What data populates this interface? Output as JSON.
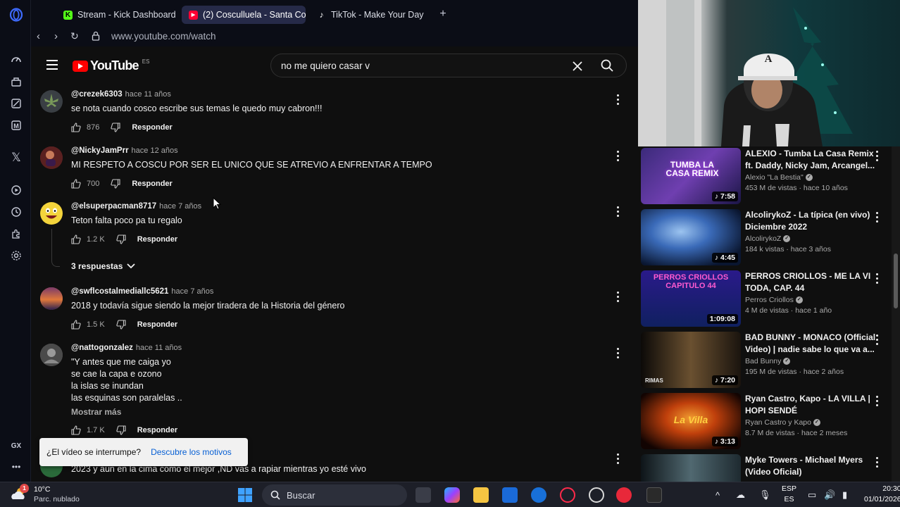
{
  "tabs": [
    {
      "label": "Stream - Kick Dashboard",
      "fav": "K",
      "fav_color": "#53fc18"
    },
    {
      "label": "(2) Cosculluela - Santa Co",
      "fav": "▶",
      "fav_color": "#ff0033"
    },
    {
      "label": "TikTok - Make Your Day",
      "fav": "♪",
      "fav_color": "#ffffff"
    }
  ],
  "address": {
    "url": "www.youtube.com/watch"
  },
  "youtube": {
    "logo_text": "YouTube",
    "country": "ES",
    "search_query": "no me quiero casar v"
  },
  "comments": [
    {
      "user": "@crezek6303",
      "time": "hace 11 años",
      "lines": [
        "se nota cuando cosco escribe sus temas le quedo muy cabron!!!"
      ],
      "likes": "876",
      "reply": "Responder"
    },
    {
      "user": "@NickyJamPrr",
      "time": "hace 12 años",
      "lines": [
        "MI RESPETO A COSCU POR SER EL UNICO QUE SE ATREVIO A ENFRENTAR A TEMPO"
      ],
      "likes": "700",
      "reply": "Responder"
    },
    {
      "user": "@elsuperpacman8717",
      "time": "hace 7 años",
      "lines": [
        "Teton falta poco pa tu regalo"
      ],
      "likes": "1.2 K",
      "reply": "Responder",
      "replies_label": "3 respuestas"
    },
    {
      "user": "@swflcostalmediallc5621",
      "time": "hace 7 años",
      "lines": [
        "2018 y todavía sigue siendo la mejor tiradera de la Historia del género"
      ],
      "likes": "1.5 K",
      "reply": "Responder"
    },
    {
      "user": "@nattogonzalez",
      "time": "hace 11 años",
      "lines": [
        "\"Y antes que me caiga yo",
        "se cae la capa e ozono",
        "la islas se inundan",
        "las esquinas son paralelas .."
      ],
      "more": "Mostrar más",
      "likes": "1.7 K",
      "reply": "Responder"
    },
    {
      "user": "",
      "time": "",
      "lines": [
        "2023 y aún en la cima como el mejor ,ND vas a rapiar mientras yo esté vivo"
      ],
      "likes": "",
      "reply": ""
    }
  ],
  "toast": {
    "text": "¿El vídeo se interrumpe?",
    "link": "Descubre los motivos"
  },
  "suggestions": [
    {
      "title": "ALEXIO - Tumba La Casa Remix ft. Daddy, Nicky Jam, Arcangel...",
      "channel": "Alexio \"La Bestia\"",
      "meta": "453 M de vistas · hace 10 años",
      "duration": "♪ 7:58",
      "thumb_text": "TUMBA LA CASA REMIX",
      "colors": [
        "#3b2a7a",
        "#6f3fb0",
        "#1a1545"
      ]
    },
    {
      "title": "AlcolirykoZ - La típica (en vivo) Diciembre 2022",
      "channel": "AlcolirykoZ",
      "meta": "184 k vistas · hace 3 años",
      "duration": "♪ 4:45",
      "thumb_text": "",
      "colors": [
        "#1c3c78",
        "#7aa8e8",
        "#0a1630"
      ]
    },
    {
      "title": "PERROS CRIOLLOS - ME LA VI TODA, CAP. 44",
      "channel": "Perros Criollos",
      "meta": "4 M de vistas · hace 1 año",
      "duration": "1:09:08",
      "thumb_text": "PERROS CRIOLLOS CAPITULO 44",
      "colors": [
        "#2a1a8a",
        "#e040c0",
        "#102060"
      ]
    },
    {
      "title": "BAD BUNNY - MONACO (Official Video) | nadie sabe lo que va a...",
      "channel": "Bad Bunny",
      "meta": "195 M de vistas · hace 2 años",
      "duration": "♪ 7:20",
      "thumb_text": "RIMAS",
      "colors": [
        "#1a140e",
        "#6a5030",
        "#0c0a08"
      ]
    },
    {
      "title": "Ryan Castro, Kapo - LA VILLA | HOPI SENDÉ",
      "channel": "Ryan Castro  y Kapo",
      "meta": "8.7 M de vistas · hace 2 meses",
      "duration": "♪ 3:13",
      "thumb_text": "La Villa",
      "colors": [
        "#3a0e04",
        "#e85a10",
        "#120402"
      ]
    },
    {
      "title": "Myke Towers - Michael Myers (Video Oficial)",
      "channel": "",
      "meta": "",
      "duration": "",
      "thumb_text": "",
      "colors": [
        "#1e2a30",
        "#506870",
        "#0e1418"
      ]
    }
  ],
  "taskbar": {
    "temp": "10°C",
    "condition": "Parc. nublado",
    "weather_badge": "1",
    "search_placeholder": "Buscar",
    "lang_top": "ESP",
    "lang_bottom": "ES",
    "time": "20:30",
    "date": "01/01/2026"
  },
  "opera_sidebar": {
    "gx_label": "GX"
  }
}
